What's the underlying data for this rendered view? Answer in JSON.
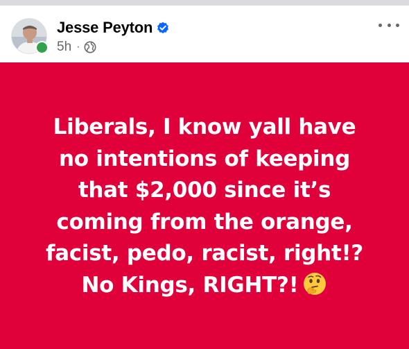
{
  "post": {
    "author": {
      "name": "Jesse Peyton",
      "verified_icon": "verified-badge-icon",
      "avatar_icon": "avatar",
      "online": true
    },
    "meta": {
      "time": "5h",
      "separator": "·",
      "audience_icon": "globe-icon"
    },
    "more_icon": "more-options-icon",
    "background_color": "#e0003a",
    "text_color": "#ffffff",
    "lines": [
      "Liberals, I know yall have",
      "no intentions of keeping",
      "that $2,000 since it’s",
      "coming from the orange,",
      "facist, pedo, racist, right!?",
      "No Kings, RIGHT?!"
    ],
    "emoji": "thinking-face-icon"
  },
  "colors": {
    "accent_blue": "#0866ff",
    "online_green": "#31a24c",
    "meta_gray": "#65676b"
  }
}
